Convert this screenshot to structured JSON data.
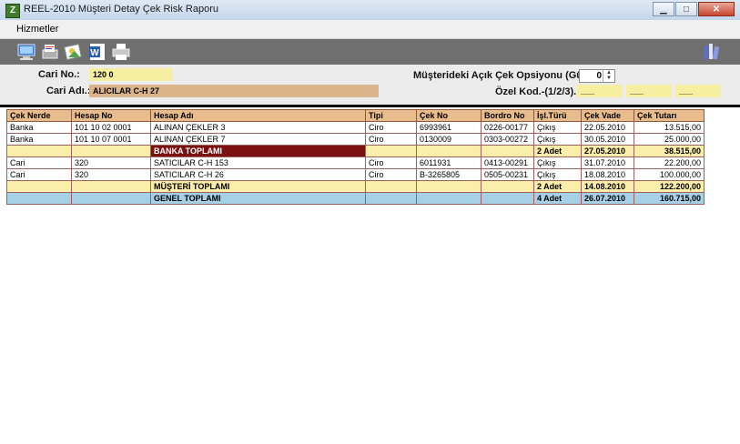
{
  "window": {
    "title": "REEL-2010 Müşteri Detay Çek Risk Raporu",
    "app_icon_letter": "Z"
  },
  "menu": {
    "items": [
      "Hizmetler"
    ]
  },
  "toolbar": {
    "buttons": [
      "computer-icon",
      "print-preview-icon",
      "image-icon",
      "word-icon",
      "printer-icon",
      "books-icon"
    ]
  },
  "form": {
    "cari_no_label": "Cari No.:",
    "cari_no_value": "120 0",
    "cari_adi_label": "Cari Adı.:",
    "cari_adi_value": "ALICILAR C-H 27",
    "opsiyon_label": "Müşterideki Açık Çek Opsiyonu (Gün).:",
    "opsiyon_value": "0",
    "ozel_kod_label": "Özel Kod.-(1/2/3).:",
    "ozel_kod_values": [
      "___",
      "___",
      "___"
    ]
  },
  "table": {
    "headers": [
      "Çek Nerde",
      "Hesap No",
      "Hesap Adı",
      "Tipi",
      "Çek No",
      "Bordro No",
      "İşl.Türü",
      "Çek Vade",
      "Çek Tutarı"
    ],
    "rows": [
      [
        "Banka",
        "101 10 02 0001",
        "ALINAN ÇEKLER 3",
        "Ciro",
        "6993961",
        "0226-00177",
        "Çıkış",
        "22.05.2010",
        "13.515,00"
      ],
      [
        "Banka",
        "101 10 07 0001",
        "ALINAN ÇEKLER 7",
        "Ciro",
        "0130009",
        "0303-00272",
        "Çıkış",
        "30.05.2010",
        "25.000,00"
      ],
      [
        "",
        "",
        "BANKA TOPLAMI",
        "",
        "",
        "",
        "2 Adet",
        "27.05.2010",
        "38.515,00"
      ],
      [
        "Cari",
        "320",
        "SATICILAR C-H 153",
        "Ciro",
        "6011931",
        "0413-00291",
        "Çıkış",
        "31.07.2010",
        "22.200,00"
      ],
      [
        "Cari",
        "320",
        "SATICILAR C-H 26",
        "Ciro",
        "B-3265805",
        "0505-00231",
        "Çıkış",
        "18.08.2010",
        "100.000,00"
      ],
      [
        "",
        "",
        "MÜŞTERİ TOPLAMI",
        "",
        "",
        "",
        "2 Adet",
        "14.08.2010",
        "122.200,00"
      ],
      [
        "",
        "",
        "GENEL TOPLAMI",
        "",
        "",
        "",
        "4 Adet",
        "26.07.2010",
        "160.715,00"
      ]
    ]
  }
}
